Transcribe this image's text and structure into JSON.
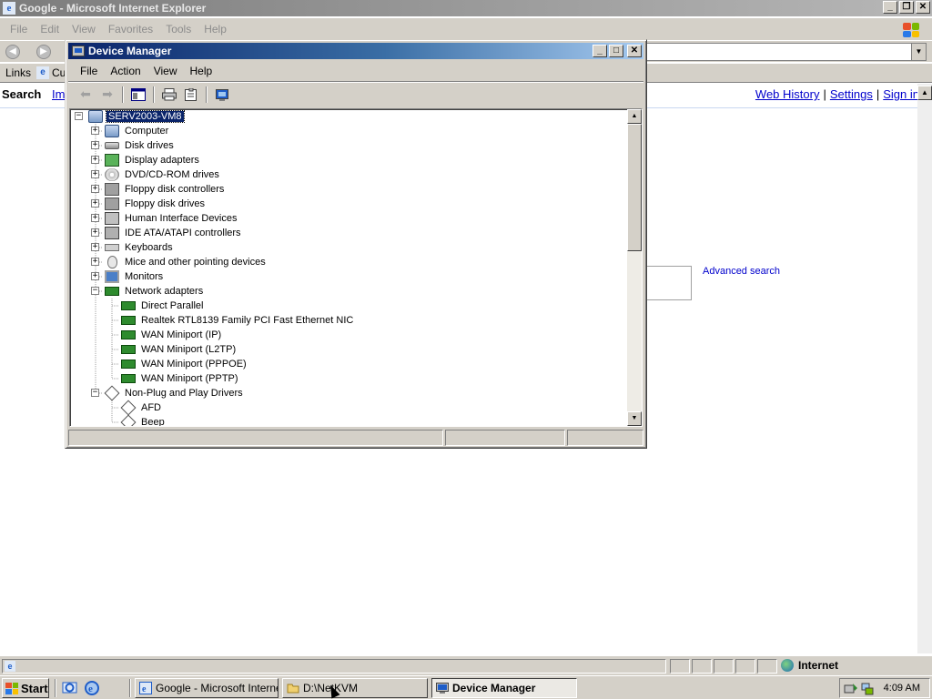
{
  "ie": {
    "title": "Google - Microsoft Internet Explorer",
    "menu": [
      "File",
      "Edit",
      "View",
      "Favorites",
      "Tools",
      "Help"
    ],
    "links_label": "Links",
    "links_item": "Cu",
    "window_buttons": [
      "_",
      "❐",
      "✕"
    ]
  },
  "google": {
    "search_label": "Search",
    "images_link": "Im",
    "top_links": [
      "Web History",
      "Settings",
      "Sign in"
    ],
    "advanced_search": "Advanced search"
  },
  "ie_status": {
    "zone": "Internet"
  },
  "device_manager": {
    "title": "Device Manager",
    "menu": [
      "File",
      "Action",
      "View",
      "Help"
    ],
    "window_buttons": [
      "_",
      "□",
      "✕"
    ],
    "tree": [
      {
        "label": "SERV2003-VM8",
        "level": 0,
        "expander": "−",
        "icon": "computer-icon",
        "selected": true
      },
      {
        "label": "Computer",
        "level": 1,
        "expander": "+",
        "icon": "computer-icon"
      },
      {
        "label": "Disk drives",
        "level": 1,
        "expander": "+",
        "icon": "disk-drive-icon"
      },
      {
        "label": "Display adapters",
        "level": 1,
        "expander": "+",
        "icon": "display-adapter-icon"
      },
      {
        "label": "DVD/CD-ROM drives",
        "level": 1,
        "expander": "+",
        "icon": "cdrom-icon"
      },
      {
        "label": "Floppy disk controllers",
        "level": 1,
        "expander": "+",
        "icon": "floppy-controller-icon"
      },
      {
        "label": "Floppy disk drives",
        "level": 1,
        "expander": "+",
        "icon": "floppy-drive-icon"
      },
      {
        "label": "Human Interface Devices",
        "level": 1,
        "expander": "+",
        "icon": "hid-icon"
      },
      {
        "label": "IDE ATA/ATAPI controllers",
        "level": 1,
        "expander": "+",
        "icon": "ide-controller-icon"
      },
      {
        "label": "Keyboards",
        "level": 1,
        "expander": "+",
        "icon": "keyboard-icon"
      },
      {
        "label": "Mice and other pointing devices",
        "level": 1,
        "expander": "+",
        "icon": "mouse-icon"
      },
      {
        "label": "Monitors",
        "level": 1,
        "expander": "+",
        "icon": "monitor-icon"
      },
      {
        "label": "Network adapters",
        "level": 1,
        "expander": "−",
        "icon": "network-adapter-icon"
      },
      {
        "label": "Direct Parallel",
        "level": 2,
        "icon": "network-adapter-icon"
      },
      {
        "label": "Realtek RTL8139 Family PCI Fast Ethernet NIC",
        "level": 2,
        "icon": "network-adapter-icon"
      },
      {
        "label": "WAN Miniport (IP)",
        "level": 2,
        "icon": "network-adapter-icon"
      },
      {
        "label": "WAN Miniport (L2TP)",
        "level": 2,
        "icon": "network-adapter-icon"
      },
      {
        "label": "WAN Miniport (PPPOE)",
        "level": 2,
        "icon": "network-adapter-icon"
      },
      {
        "label": "WAN Miniport (PPTP)",
        "level": 2,
        "icon": "network-adapter-icon"
      },
      {
        "label": "Non-Plug and Play Drivers",
        "level": 1,
        "expander": "−",
        "icon": "non-pnp-driver-icon"
      },
      {
        "label": "AFD",
        "level": 2,
        "icon": "non-pnp-driver-icon"
      },
      {
        "label": "Beep",
        "level": 2,
        "icon": "non-pnp-driver-icon"
      }
    ]
  },
  "taskbar": {
    "start_label": "Start",
    "tasks": [
      {
        "label": "Google - Microsoft Interne...",
        "icon": "ie-icon",
        "active": false
      },
      {
        "label": "D:\\NetKVM",
        "icon": "folder-icon",
        "active": false
      },
      {
        "label": "Device Manager",
        "icon": "device-manager-icon",
        "active": true
      }
    ],
    "clock": "4:09 AM"
  }
}
